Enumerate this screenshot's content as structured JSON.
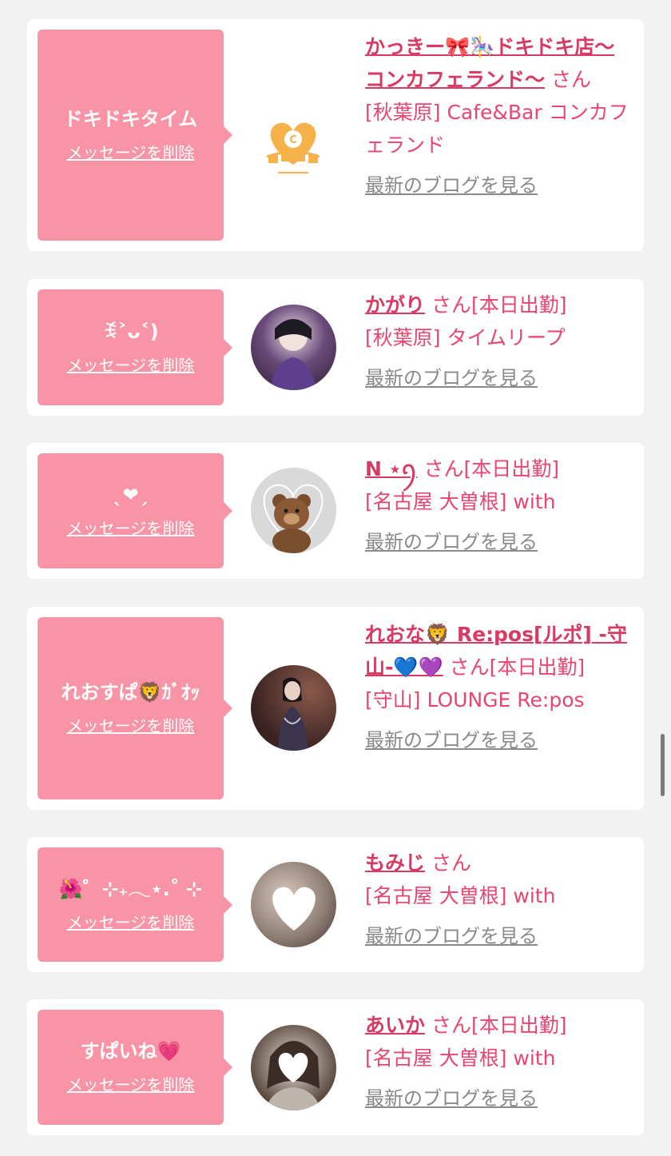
{
  "cards": [
    {
      "message": "ドキドキタイム",
      "delete_label": "メッセージを削除",
      "avatar_icon": "cafe-land-logo-icon",
      "name": "かっきー🎀🎠ドキドキ店〜コンカフェランド〜",
      "suffix": "さん",
      "shop": "[秋葉原] Cafe&Bar コンカフェランド",
      "blog_label": "最新のブログを見る"
    },
    {
      "message": "ꉂ˃ᴗ˂)",
      "delete_label": "メッセージを削除",
      "avatar_icon": "profile-photo-icon",
      "name": "かがり",
      "suffix": "さん[本日出勤]",
      "shop": "[秋葉原] タイムリープ",
      "blog_label": "最新のブログを見る"
    },
    {
      "message": "ˎ❤︎ˏ",
      "delete_label": "メッセージを削除",
      "avatar_icon": "teddy-bear-photo-icon",
      "name": "N ⋆ꪆ",
      "suffix": "さん[本日出勤]",
      "shop": "[名古屋 大曽根] with",
      "blog_label": "最新のブログを見る"
    },
    {
      "message": "れおすぱ🦁ｶﾞｵｯ",
      "delete_label": "メッセージを削除",
      "avatar_icon": "profile-photo-icon",
      "name": "れおな🦁 Re:pos[ルポ] -守山-💙💜",
      "suffix": "さん[本日出勤]",
      "shop": "[守山] LOUNGE Re:pos",
      "blog_label": "最新のブログを見る"
    },
    {
      "message": "🌺゜⊹₊𓂃⋆.˚ ⊹",
      "delete_label": "メッセージを削除",
      "avatar_icon": "profile-photo-icon",
      "name": "もみじ",
      "suffix": "さん",
      "shop": "[名古屋 大曽根] with",
      "blog_label": "最新のブログを見る"
    },
    {
      "message": "すぱいね💗",
      "delete_label": "メッセージを削除",
      "avatar_icon": "profile-photo-icon",
      "name": "あいか",
      "suffix": "さん[本日出勤]",
      "shop": "[名古屋 大曽根] with",
      "blog_label": "最新のブログを見る"
    }
  ],
  "colors": {
    "message_bg": "#f993a6",
    "name": "#d83a64",
    "text": "#e94570",
    "blog_link": "#8a8a8a",
    "page_bg": "#f2f2f2"
  }
}
